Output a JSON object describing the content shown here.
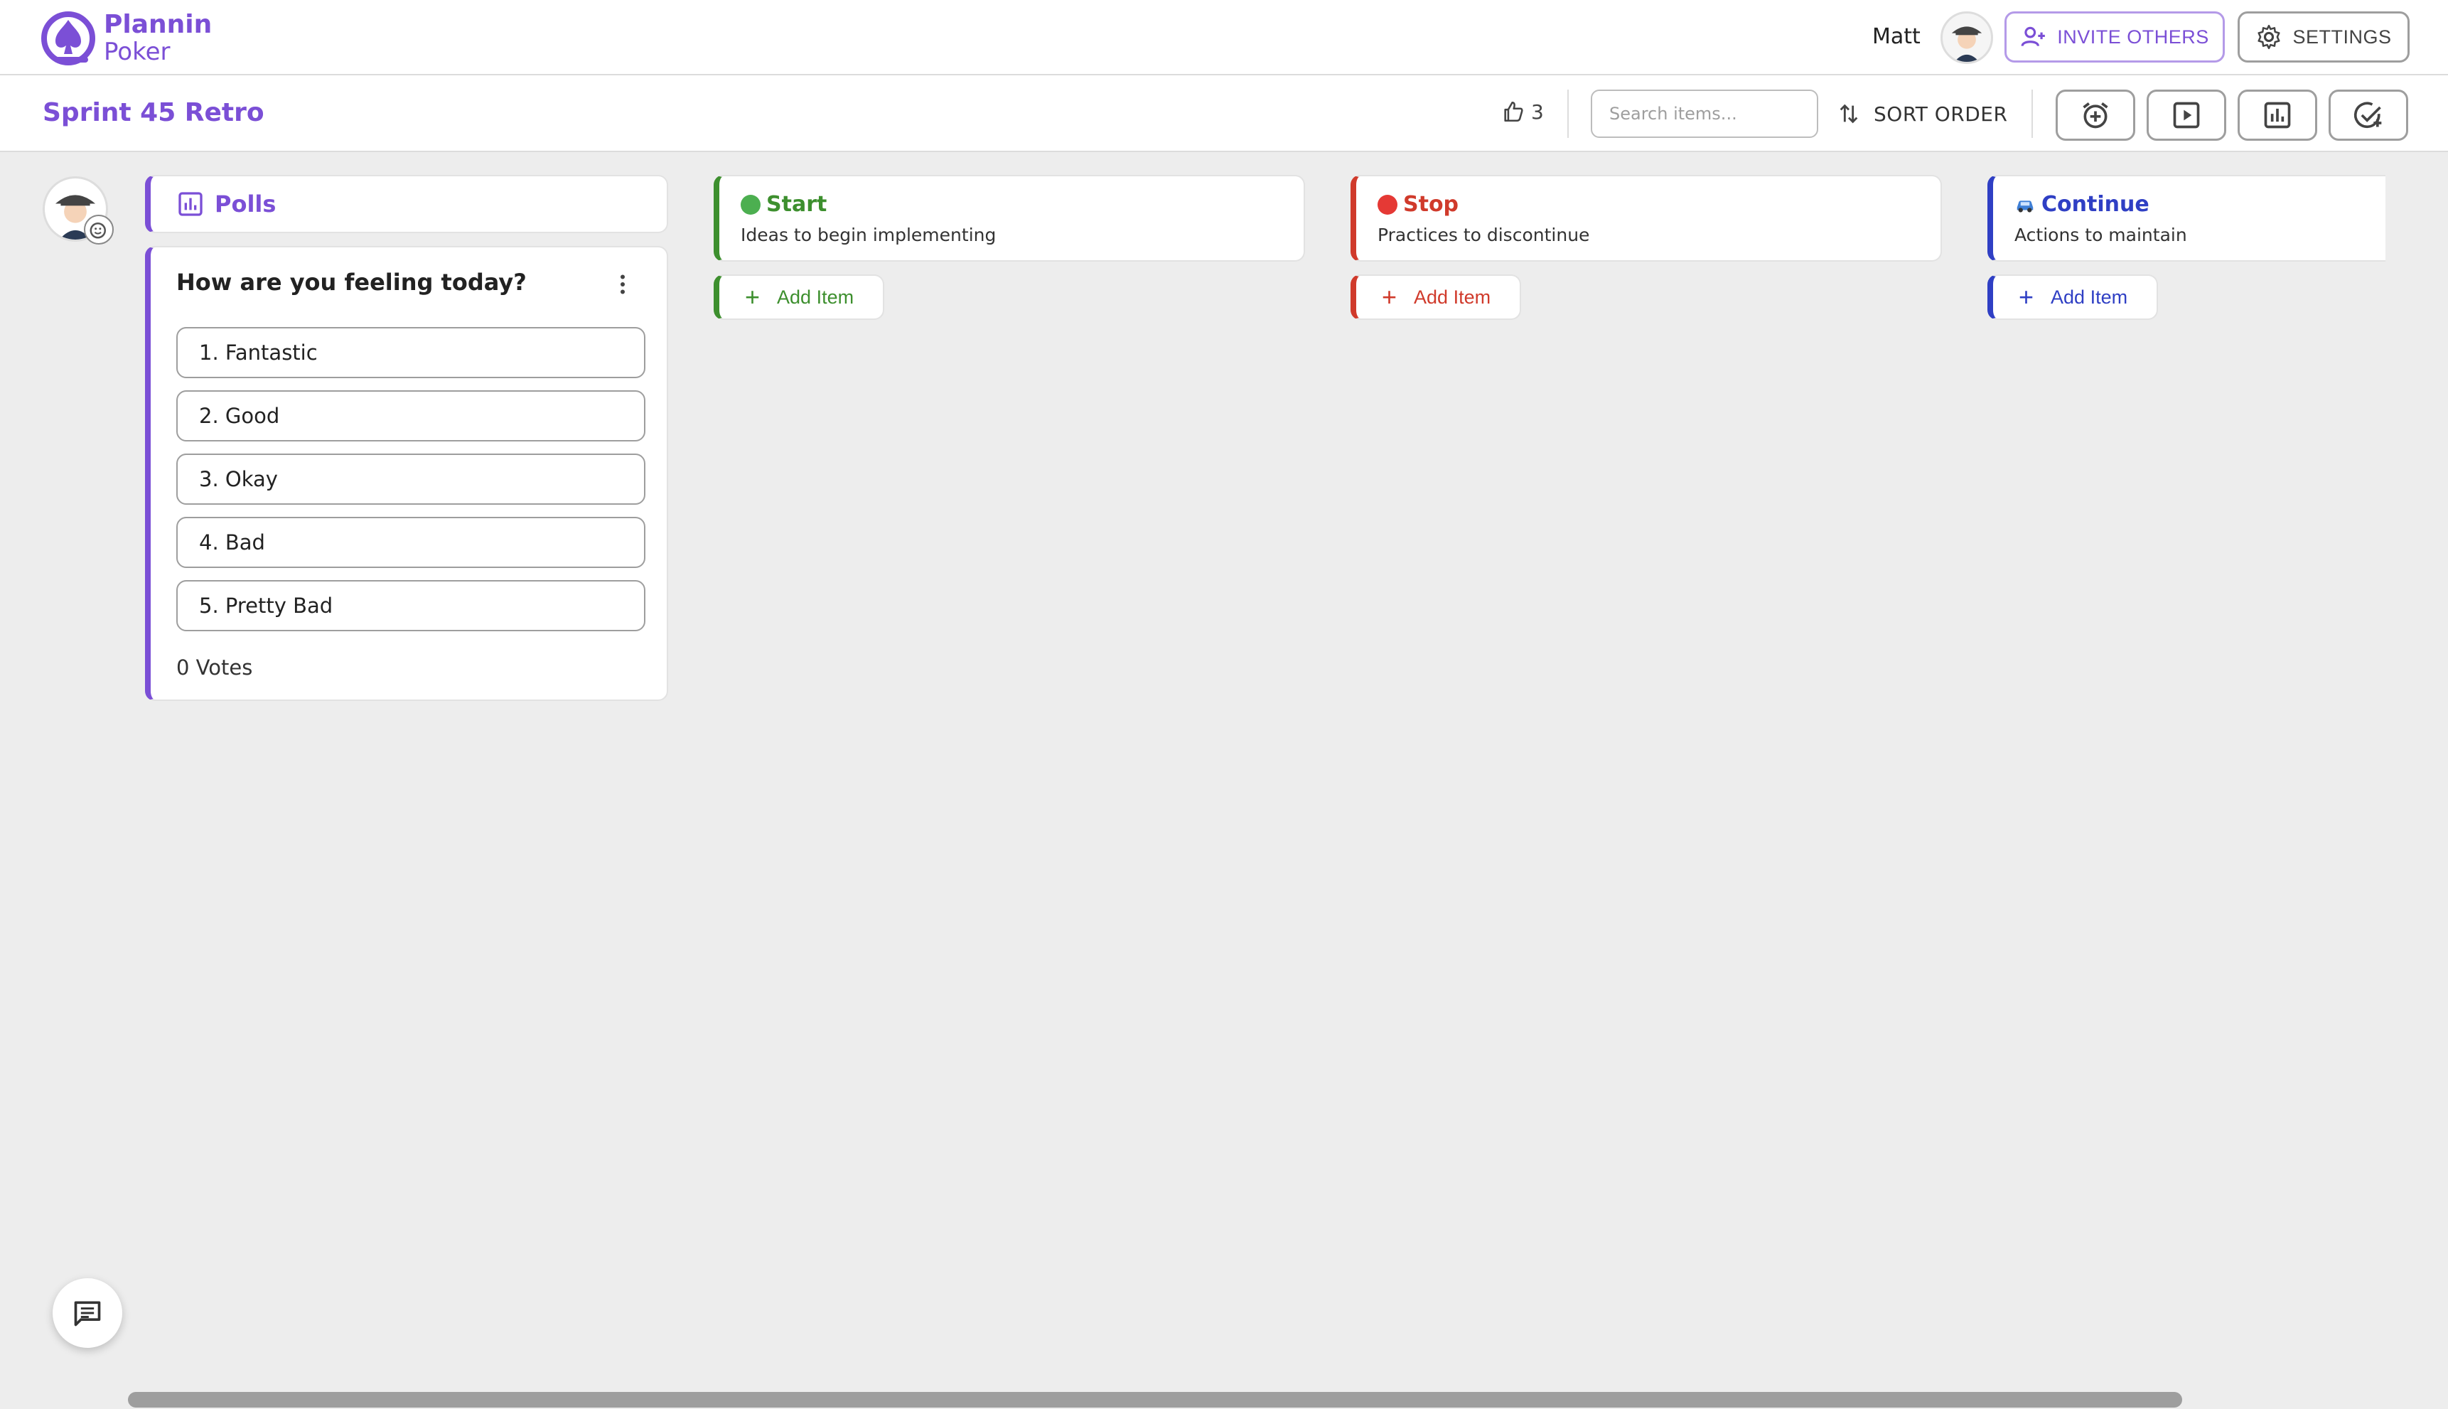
{
  "app": {
    "logo_line1": "Plannin",
    "logo_line2": "Poker",
    "brand_color": "#7b4fd6"
  },
  "header": {
    "user_name": "Matt",
    "invite_label": "INVITE OTHERS",
    "settings_label": "SETTINGS"
  },
  "toolbar": {
    "board_title": "Sprint 45 Retro",
    "likes_count": "3",
    "search_placeholder": "Search items...",
    "sort_label": "SORT ORDER",
    "tool_icons": [
      "add-alarm-icon",
      "play-icon",
      "chart-icon",
      "add-task-icon"
    ]
  },
  "polls": {
    "header": "Polls",
    "question": "How are you feeling today?",
    "options": [
      "1. Fantastic",
      "2. Good",
      "3. Okay",
      "4. Bad",
      "5. Pretty Bad"
    ],
    "votes": "0 Votes"
  },
  "columns": [
    {
      "title": "Start",
      "description": "Ideas to begin implementing",
      "add_label": "Add Item",
      "color": "#3d8f2e",
      "icon": "green-circle-icon"
    },
    {
      "title": "Stop",
      "description": "Practices to discontinue",
      "add_label": "Add Item",
      "color": "#d03a2b",
      "icon": "red-circle-icon"
    },
    {
      "title": "Continue",
      "description": "Actions to maintain",
      "add_label": "Add Item",
      "color": "#2f3fc4",
      "icon": "car-icon"
    }
  ]
}
